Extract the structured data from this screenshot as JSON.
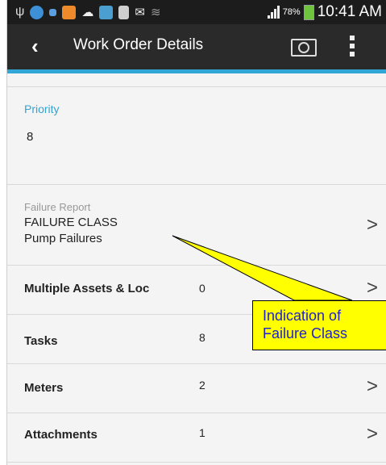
{
  "status_bar": {
    "battery": "78%",
    "time": "10:41 AM",
    "icons": [
      "usb-icon",
      "app-icon",
      "notification-icon",
      "app-icon",
      "cloud-icon",
      "app-icon",
      "app-icon",
      "mail-icon",
      "wifi-icon",
      "signal-icon",
      "battery-icon"
    ]
  },
  "action_bar": {
    "back_icon": "‹",
    "title": "Work Order Details",
    "camera_icon": "camera-icon",
    "menu_icon": "overflow-menu-icon"
  },
  "priority": {
    "label": "Priority",
    "value": "8"
  },
  "failure_report": {
    "label": "Failure Report",
    "class": "FAILURE CLASS",
    "value": "Pump Failures"
  },
  "list": [
    {
      "label": "Multiple Assets & Loc",
      "count": "0"
    },
    {
      "label": "Tasks",
      "count": "8"
    },
    {
      "label": "Meters",
      "count": "2"
    },
    {
      "label": "Attachments",
      "count": "1"
    }
  ],
  "chevron": ">",
  "callout": {
    "line1": "Indication of",
    "line2": "Failure Class"
  },
  "colors": {
    "accent": "#32a7d7",
    "callout_fill": "#ffff00",
    "callout_text": "#2222c8",
    "actionbar": "#2a2a2a"
  }
}
